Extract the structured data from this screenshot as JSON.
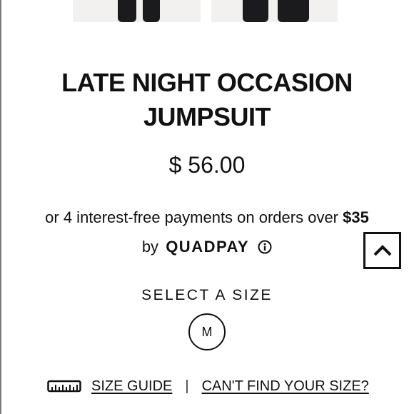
{
  "product": {
    "title_line1": "LATE NIGHT OCCASION",
    "title_line2": "JUMPSUIT",
    "price": "$ 56.00"
  },
  "installments": {
    "text": "or 4 interest-free payments on orders over ",
    "threshold": "$35",
    "by_text": "by",
    "provider": "QUADPAY"
  },
  "size_selector": {
    "label": "SELECT A SIZE",
    "options": [
      "M"
    ]
  },
  "links": {
    "size_guide": "SIZE GUIDE ",
    "separator": "|",
    "cant_find_size": "CAN'T FIND YOUR SIZE?"
  },
  "icons": {
    "info": "info-circle-icon",
    "back_to_top": "chevron-up-icon",
    "ruler": "ruler-icon"
  }
}
